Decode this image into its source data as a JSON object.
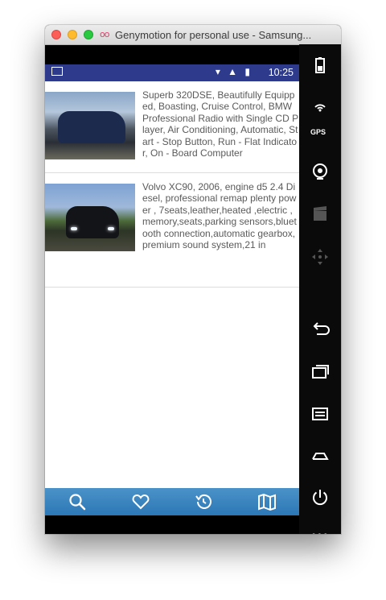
{
  "window": {
    "title": "Genymotion for personal use - Samsung...",
    "logo_text": "oo"
  },
  "statusbar": {
    "icons": "▾ ▲ ▮",
    "time": "10:25"
  },
  "listings": [
    {
      "description": "Superb 320DSE, Beautifully Equipped, Boasting, Cruise Control, BMW Professional Radio with Single CD Player, Air Conditioning, Automatic, Start - Stop Button, Run - Flat Indicator, On - Board Computer"
    },
    {
      "description": "Volvo XC90, 2006, engine d5 2.4 Diesel, professional remap plenty power , 7seats,leather,heated ,electric ,memory,seats,parking sensors,bluetooth connection,automatic gearbox,premium sound system,21 in"
    }
  ],
  "bottom_nav": [
    {
      "icon": "search-icon"
    },
    {
      "icon": "heart-icon"
    },
    {
      "icon": "history-icon"
    },
    {
      "icon": "map-icon"
    }
  ],
  "emulator_sidebar": {
    "gps_label": "GPS",
    "more_label": "•••"
  },
  "colors": {
    "statusbar": "#2e3a8c",
    "bottom_nav": "#2c77b6",
    "text": "#5a5a5a"
  }
}
